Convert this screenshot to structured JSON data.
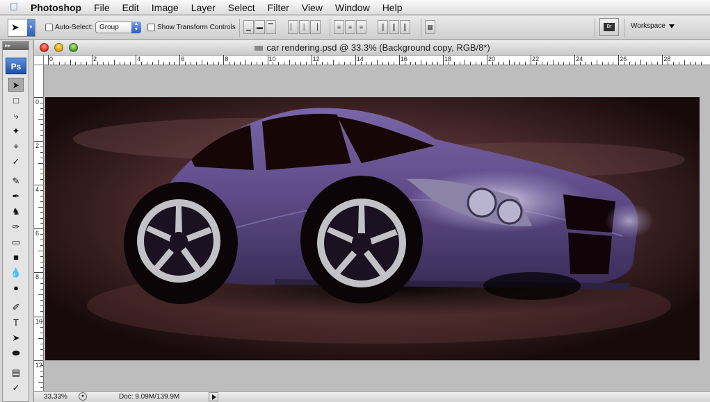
{
  "menubar": {
    "app_name": "Photoshop",
    "items": [
      "File",
      "Edit",
      "Image",
      "Layer",
      "Select",
      "Filter",
      "View",
      "Window",
      "Help"
    ]
  },
  "options_bar": {
    "auto_select_label": "Auto-Select:",
    "auto_select_checked": false,
    "auto_select_value": "Group",
    "show_transform_label": "Show Transform Controls",
    "show_transform_checked": false,
    "workspace_label": "Workspace"
  },
  "toolbox": {
    "logo": "Ps",
    "tools": [
      "move-icon",
      "marquee-icon",
      "lasso-icon",
      "magic-wand-icon",
      "crop-icon",
      "eyedropper-icon",
      "healing-brush-icon",
      "brush-icon",
      "clone-stamp-icon",
      "history-brush-icon",
      "eraser-icon",
      "gradient-icon",
      "blur-icon",
      "dodge-icon",
      "pen-icon",
      "type-icon",
      "path-selection-icon",
      "shape-icon",
      "notes-icon",
      "eyedropper-icon"
    ]
  },
  "document": {
    "title": "car rendering.psd @ 33.3% (Background copy, RGB/8*)",
    "ruler_h_labels": [
      "0",
      "2",
      "4",
      "6",
      "8",
      "10",
      "12",
      "14",
      "16",
      "18",
      "20",
      "22",
      "24",
      "26",
      "28"
    ],
    "ruler_v_labels": [
      "0",
      "2",
      "4",
      "6",
      "8",
      "10",
      "12"
    ],
    "zoom": "33.33%",
    "doc_info": "Doc: 9.09M/139.9M"
  },
  "colors": {
    "car_body": "#5e4a86",
    "background_glow": "#5a3436",
    "canvas_dark": "#1a0c0d"
  }
}
